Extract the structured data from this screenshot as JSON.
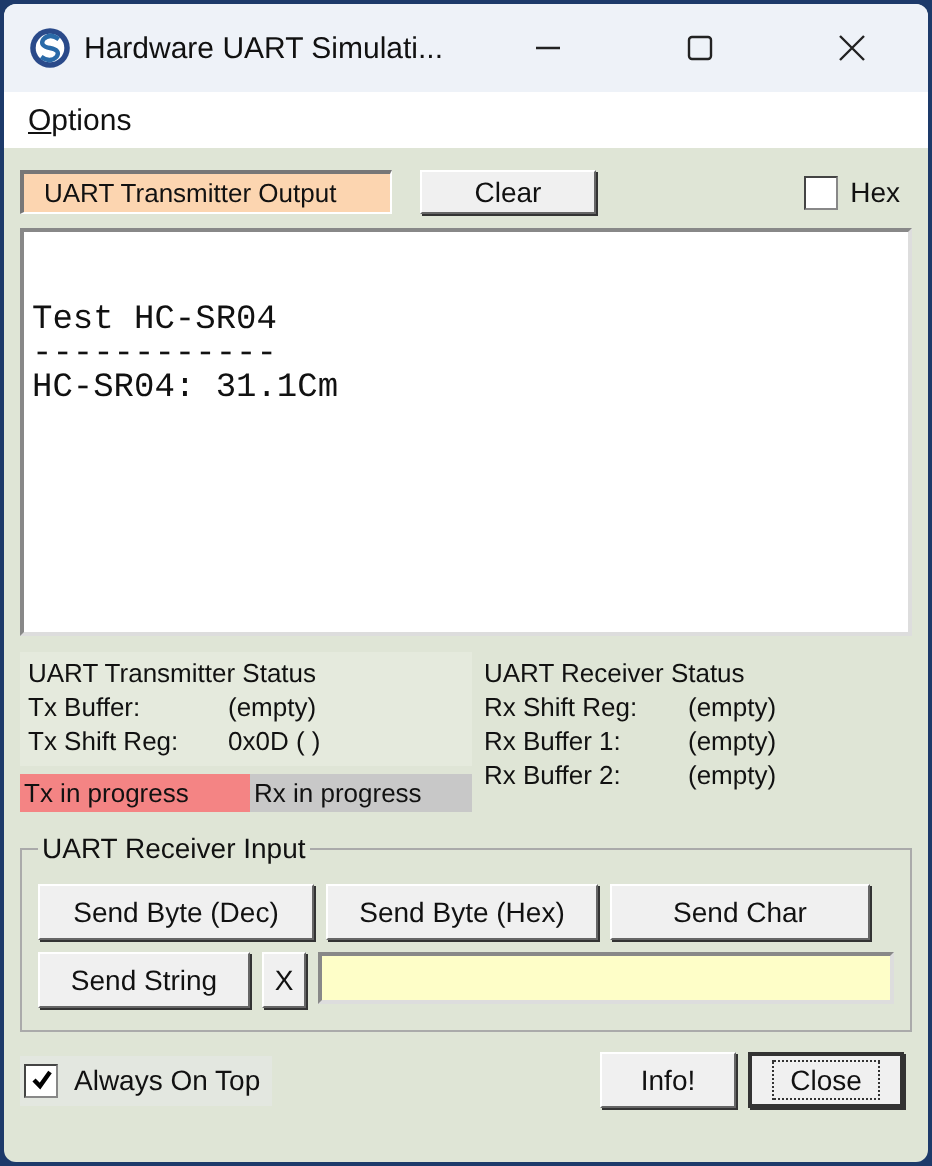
{
  "window": {
    "title": "Hardware UART Simulati..."
  },
  "menu": [
    {
      "label": "Options"
    }
  ],
  "toolbar": {
    "output_label": "UART Transmitter Output",
    "clear_button": "Clear",
    "hex": {
      "label": "Hex",
      "checked": false
    }
  },
  "output": {
    "lines": [
      "Test HC-SR04",
      "------------",
      "HC-SR04: 31.1Cm"
    ]
  },
  "tx_status": {
    "title": "UART Transmitter Status",
    "rows": [
      {
        "label": "Tx Buffer:",
        "value": "(empty)"
      },
      {
        "label": "Tx Shift Reg:",
        "value": "0x0D ( )"
      }
    ]
  },
  "rx_status": {
    "title": "UART Receiver Status",
    "rows": [
      {
        "label": "Rx Shift Reg:",
        "value": "(empty)"
      },
      {
        "label": "Rx Buffer 1:",
        "value": "(empty)"
      },
      {
        "label": "Rx Buffer 2:",
        "value": "(empty)"
      }
    ]
  },
  "indicators": [
    {
      "label": "Tx in progress",
      "active": true
    },
    {
      "label": "Rx in progress",
      "active": false
    }
  ],
  "receiver_input": {
    "title": "UART Receiver Input",
    "buttons": [
      "Send Byte (Dec)",
      "Send Byte (Hex)",
      "Send Char"
    ],
    "send_string": "Send String",
    "clear_x": "X"
  },
  "always_on_top": {
    "label": "Always On Top",
    "checked": true
  },
  "buttons": [
    {
      "label": "Info!",
      "focused": false
    },
    {
      "label": "Close",
      "focused": true
    }
  ]
}
